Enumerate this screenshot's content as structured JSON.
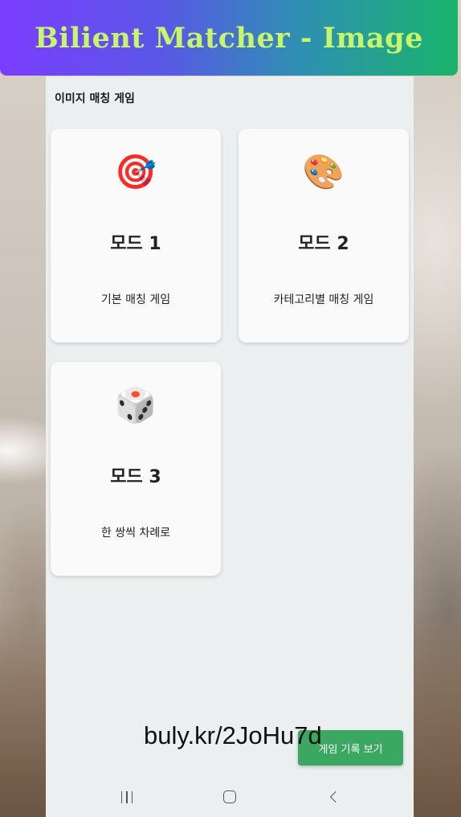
{
  "banner": {
    "title": "Bilient Matcher - Image"
  },
  "app": {
    "title": "이미지 매칭 게임"
  },
  "modes": [
    {
      "icon": "🎯",
      "icon_name": "target-icon",
      "title": "모드 1",
      "description": "기본 매칭 게임"
    },
    {
      "icon": "🎨",
      "icon_name": "palette-icon",
      "title": "모드 2",
      "description": "카테고리별 매칭 게임"
    },
    {
      "icon": "🎲",
      "icon_name": "dice-icon",
      "title": "모드 3",
      "description": "한 쌍씩 차례로"
    }
  ],
  "history_button": {
    "label": "게임 기록 보기"
  },
  "watermark": {
    "text": "buly.kr/2JoHu7d"
  },
  "navbar": {
    "items": [
      "recent-apps",
      "home",
      "back"
    ]
  },
  "colors": {
    "banner_start": "#7b3dff",
    "banner_end": "#19b46a",
    "banner_text": "#c9f56a",
    "button_green": "#3ba862",
    "screen_bg": "#eceff0",
    "card_bg": "#fafafa"
  }
}
